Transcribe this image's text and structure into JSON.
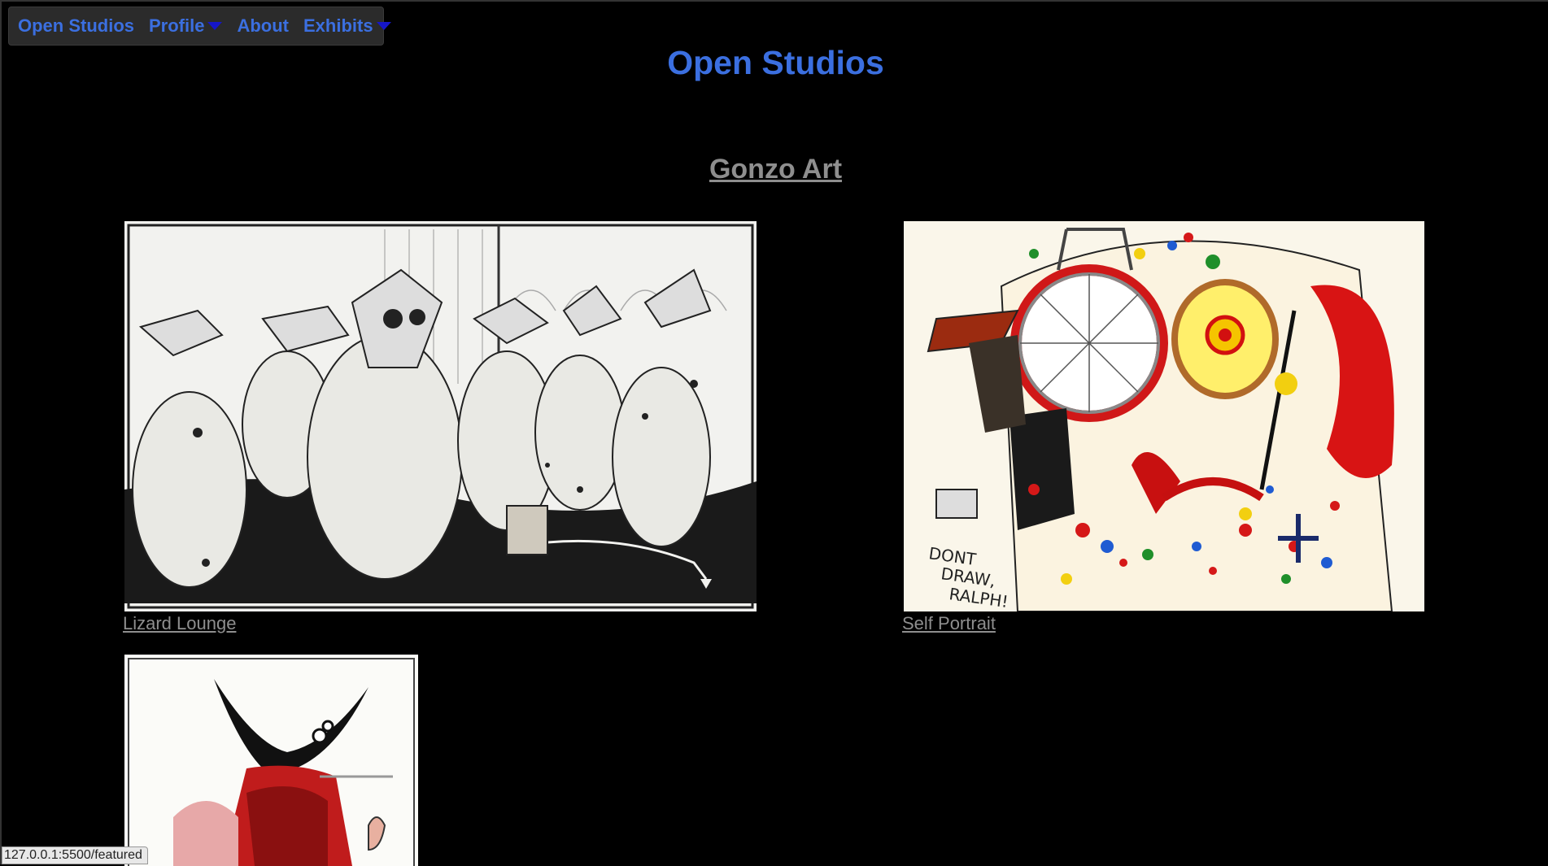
{
  "nav": {
    "brand": "Open Studios",
    "items": [
      {
        "label": "Profile",
        "dropdown": true
      },
      {
        "label": "About",
        "dropdown": false
      },
      {
        "label": "Exhibits",
        "dropdown": true
      }
    ]
  },
  "header": {
    "title": "Open Studios"
  },
  "section": {
    "title": "Gonzo Art"
  },
  "gallery": [
    {
      "caption": "Lizard Lounge"
    },
    {
      "caption": "Self Portrait"
    },
    {
      "caption": ""
    }
  ],
  "status_bar": {
    "url": "127.0.0.1:5500/featured"
  },
  "colors": {
    "link": "#3b6fe0",
    "caption": "#8e8e8e",
    "background": "#000000",
    "caret": "#1616c8"
  }
}
